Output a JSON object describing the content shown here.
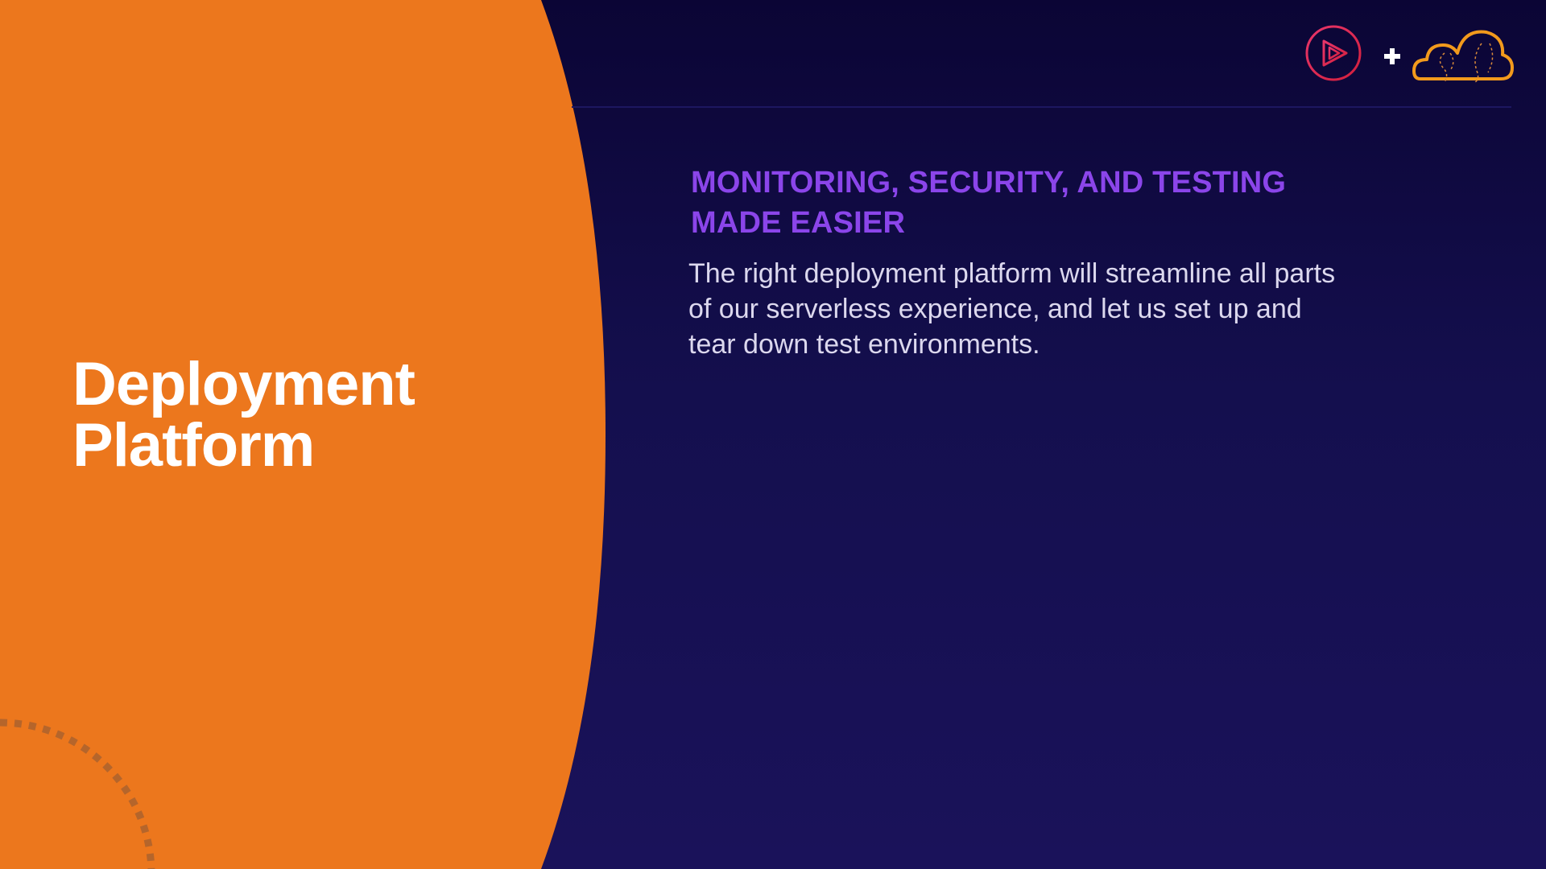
{
  "slide": {
    "title_line1": "Deployment",
    "title_line2": "Platform",
    "headline": "MONITORING, SECURITY, AND TESTING MADE EASIER",
    "body": "The right deployment platform will streamline all parts of our serverless experience, and let us set up and tear down test environments."
  },
  "branding": {
    "left_logo_icon": "play-circle-icon",
    "separator_icon": "plus-icon",
    "right_logo_icon": "cloud-icon"
  },
  "colors": {
    "background": "#140f4e",
    "orange_panel": "#ec771d",
    "headline": "#8b45ea",
    "body_text": "#dcd8ee",
    "title_text": "#ffffff",
    "play_logo": "#e3234b",
    "cloud_logo": "#f29a1c"
  }
}
